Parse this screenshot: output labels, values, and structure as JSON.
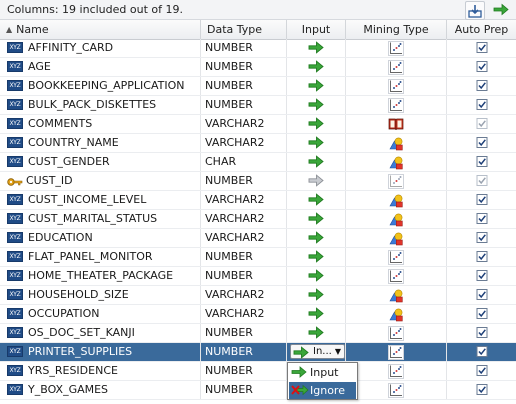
{
  "toolbar": {
    "summary": "Columns: 19 included out of 19.",
    "export_icon": "export-icon",
    "go_icon": "green-arrow-icon"
  },
  "columns": {
    "name": "Name",
    "data_type": "Data Type",
    "input": "Input",
    "mining_type": "Mining Type",
    "auto_prep": "Auto Prep"
  },
  "rows": [
    {
      "name": "AFFINITY_CARD",
      "type": "NUMBER",
      "input": "input",
      "mining": "numerical",
      "auto": true,
      "auto_disabled": false
    },
    {
      "name": "AGE",
      "type": "NUMBER",
      "input": "input",
      "mining": "numerical",
      "auto": true,
      "auto_disabled": false
    },
    {
      "name": "BOOKKEEPING_APPLICATION",
      "type": "NUMBER",
      "input": "input",
      "mining": "numerical",
      "auto": true,
      "auto_disabled": false
    },
    {
      "name": "BULK_PACK_DISKETTES",
      "type": "NUMBER",
      "input": "input",
      "mining": "numerical",
      "auto": true,
      "auto_disabled": false
    },
    {
      "name": "COMMENTS",
      "type": "VARCHAR2",
      "input": "input",
      "mining": "text",
      "auto": true,
      "auto_disabled": true
    },
    {
      "name": "COUNTRY_NAME",
      "type": "VARCHAR2",
      "input": "input",
      "mining": "categorical",
      "auto": true,
      "auto_disabled": false
    },
    {
      "name": "CUST_GENDER",
      "type": "CHAR",
      "input": "input",
      "mining": "categorical",
      "auto": true,
      "auto_disabled": false
    },
    {
      "name": "CUST_ID",
      "type": "NUMBER",
      "input": "disabled",
      "mining": "numerical-disabled",
      "auto": true,
      "auto_disabled": true,
      "is_key": true
    },
    {
      "name": "CUST_INCOME_LEVEL",
      "type": "VARCHAR2",
      "input": "input",
      "mining": "categorical",
      "auto": true,
      "auto_disabled": false
    },
    {
      "name": "CUST_MARITAL_STATUS",
      "type": "VARCHAR2",
      "input": "input",
      "mining": "categorical",
      "auto": true,
      "auto_disabled": false
    },
    {
      "name": "EDUCATION",
      "type": "VARCHAR2",
      "input": "input",
      "mining": "categorical",
      "auto": true,
      "auto_disabled": false
    },
    {
      "name": "FLAT_PANEL_MONITOR",
      "type": "NUMBER",
      "input": "input",
      "mining": "numerical",
      "auto": true,
      "auto_disabled": false
    },
    {
      "name": "HOME_THEATER_PACKAGE",
      "type": "NUMBER",
      "input": "input",
      "mining": "numerical",
      "auto": true,
      "auto_disabled": false
    },
    {
      "name": "HOUSEHOLD_SIZE",
      "type": "VARCHAR2",
      "input": "input",
      "mining": "categorical",
      "auto": true,
      "auto_disabled": false
    },
    {
      "name": "OCCUPATION",
      "type": "VARCHAR2",
      "input": "input",
      "mining": "categorical",
      "auto": true,
      "auto_disabled": false
    },
    {
      "name": "OS_DOC_SET_KANJI",
      "type": "NUMBER",
      "input": "input",
      "mining": "numerical",
      "auto": true,
      "auto_disabled": false
    },
    {
      "name": "PRINTER_SUPPLIES",
      "type": "NUMBER",
      "input": "combo",
      "mining": "numerical",
      "auto": true,
      "auto_disabled": false,
      "selected": true
    },
    {
      "name": "YRS_RESIDENCE",
      "type": "NUMBER",
      "input": "input",
      "mining": "numerical",
      "auto": true,
      "auto_disabled": false
    },
    {
      "name": "Y_BOX_GAMES",
      "type": "NUMBER",
      "input": "input",
      "mining": "numerical",
      "auto": true,
      "auto_disabled": false
    }
  ],
  "combo": {
    "value": "In...",
    "caret": "▼"
  },
  "dropdown": {
    "options": [
      {
        "label": "Input",
        "icon": "green-arrow-icon"
      },
      {
        "label": "Ignore",
        "icon": "ignore-icon",
        "highlighted": true
      }
    ]
  },
  "colors": {
    "selection": "#3a6a9b",
    "arrow_green": "#2c9b2c",
    "column_badge": "#1f4b86"
  }
}
